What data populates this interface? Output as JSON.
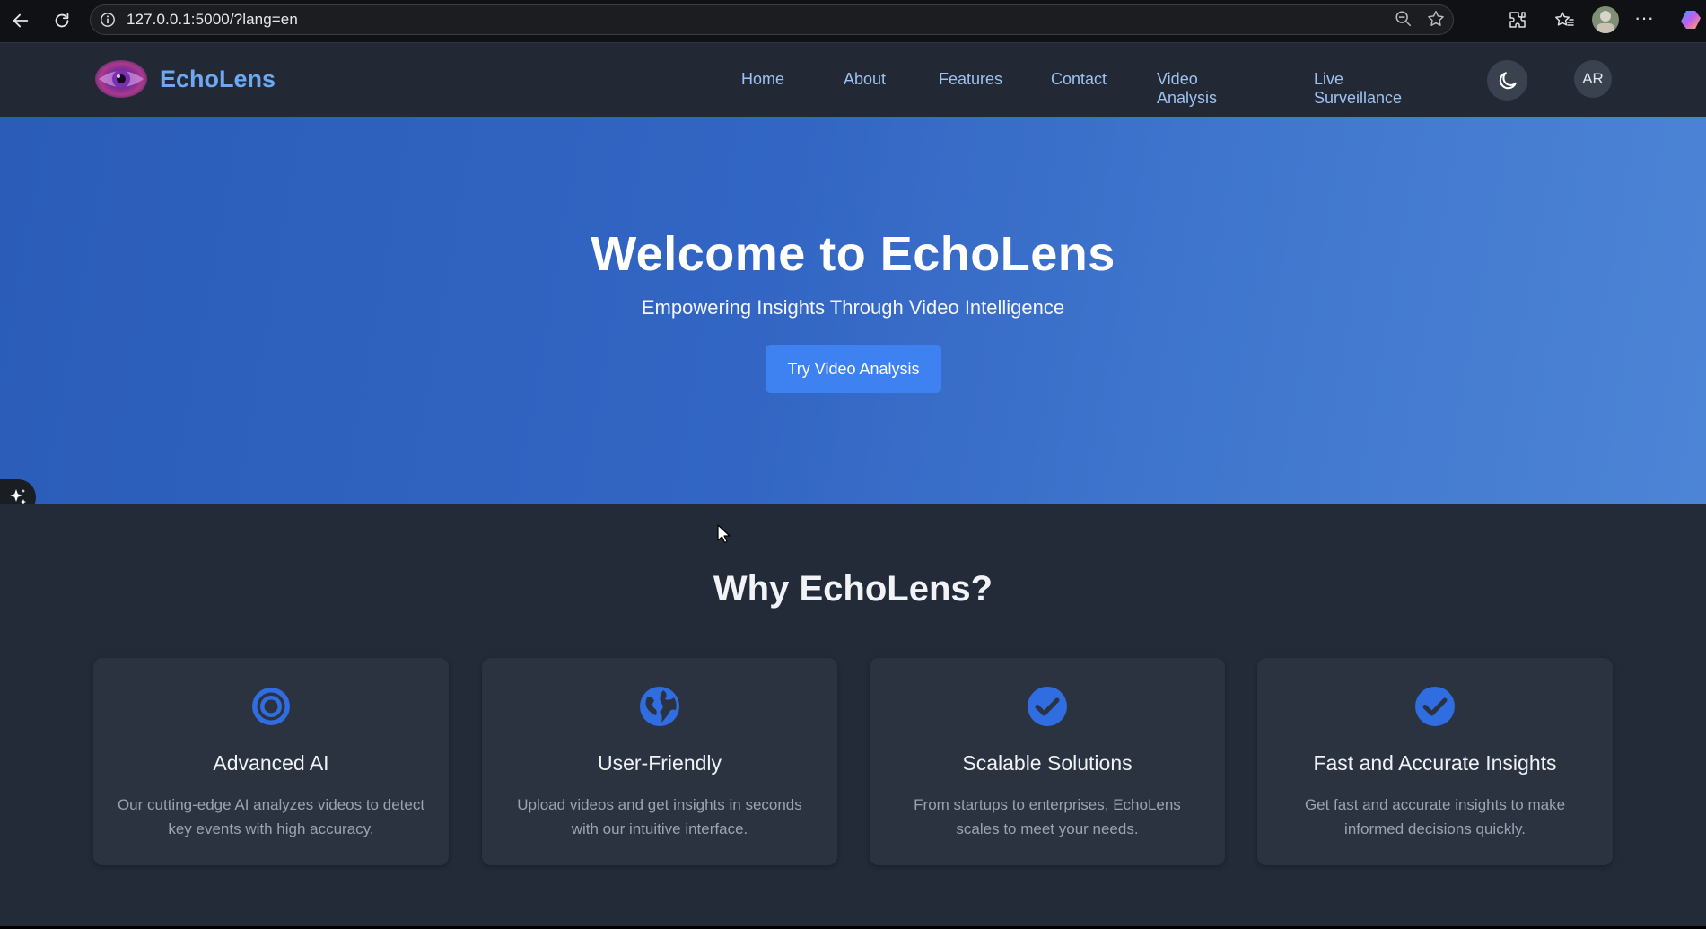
{
  "browser": {
    "url": "127.0.0.1:5000/?lang=en",
    "back_icon": "back-arrow-icon",
    "reload_icon": "reload-icon"
  },
  "navbar": {
    "brand": "EchoLens",
    "links": [
      "Home",
      "About",
      "Features",
      "Contact",
      "Video Analysis",
      "Live Surveillance"
    ],
    "theme_toggle_icon": "moon-icon",
    "lang_button": "AR"
  },
  "hero": {
    "title": "Welcome to EchoLens",
    "subtitle": "Empowering Insights Through Video Intelligence",
    "cta_label": "Try Video Analysis"
  },
  "features": {
    "heading": "Why EchoLens?",
    "cards": [
      {
        "icon": "target-icon",
        "title": "Advanced AI",
        "desc": "Our cutting-edge AI analyzes videos to detect key events with high accuracy."
      },
      {
        "icon": "globe-icon",
        "title": "User-Friendly",
        "desc": "Upload videos and get insights in seconds with our intuitive interface."
      },
      {
        "icon": "check-circle-icon",
        "title": "Scalable Solutions",
        "desc": "From startups to enterprises, EchoLens scales to meet your needs."
      },
      {
        "icon": "check-circle-icon",
        "title": "Fast and Accurate Insights",
        "desc": "Get fast and accurate insights to make informed decisions quickly."
      }
    ]
  },
  "colors": {
    "navbar_bg": "#222935",
    "brand_blue": "#6ea8f2",
    "hero_start": "#2a5cb8",
    "hero_end": "#4d84d6",
    "cta_bg": "#3d82f0",
    "section_bg": "#232a38",
    "card_bg": "#2b3240",
    "icon_blue": "#2f6de0"
  }
}
